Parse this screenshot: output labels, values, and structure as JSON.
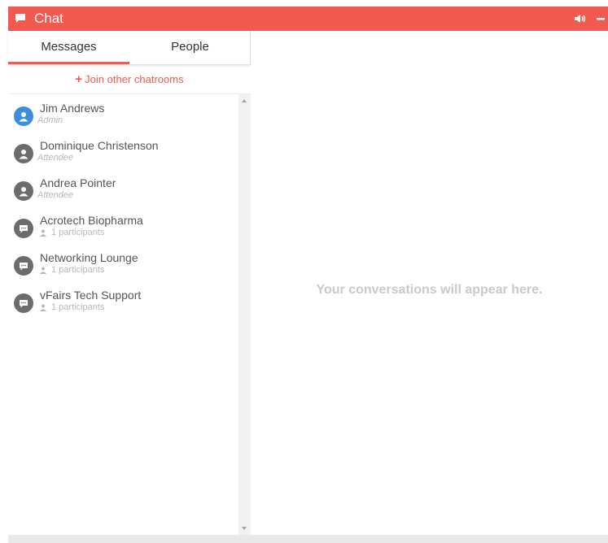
{
  "header": {
    "title": "Chat",
    "icons": {
      "chat": "chat-bubble-icon",
      "sound": "volume-icon",
      "minimize": "minimize-icon"
    }
  },
  "tabs": [
    {
      "label": "Messages",
      "active": true
    },
    {
      "label": "People",
      "active": false
    }
  ],
  "join_link": {
    "icon": "plus-icon",
    "label": "Join other chatrooms"
  },
  "conversations": [
    {
      "name": "Jim Andrews",
      "subtitle": "Admin",
      "kind": "person",
      "avatar_color": "#3c8ed9"
    },
    {
      "name": "Dominique Christenson",
      "subtitle": "Attendee",
      "kind": "person",
      "avatar_color": "#6c6c6c"
    },
    {
      "name": "Andrea Pointer",
      "subtitle": "Attendee",
      "kind": "person",
      "avatar_color": "#6c6c6c"
    },
    {
      "name": "Acrotech Biopharma",
      "subtitle": "1 participants",
      "kind": "room",
      "avatar_color": "#6c6c6c"
    },
    {
      "name": "Networking Lounge",
      "subtitle": "1 participants",
      "kind": "room",
      "avatar_color": "#6c6c6c"
    },
    {
      "name": "vFairs Tech Support",
      "subtitle": "1 participants",
      "kind": "room",
      "avatar_color": "#6c6c6c"
    }
  ],
  "main": {
    "empty_message": "Your conversations will appear here."
  },
  "colors": {
    "accent": "#f25a50",
    "blue": "#3c8ed9",
    "grey": "#6c6c6c"
  }
}
